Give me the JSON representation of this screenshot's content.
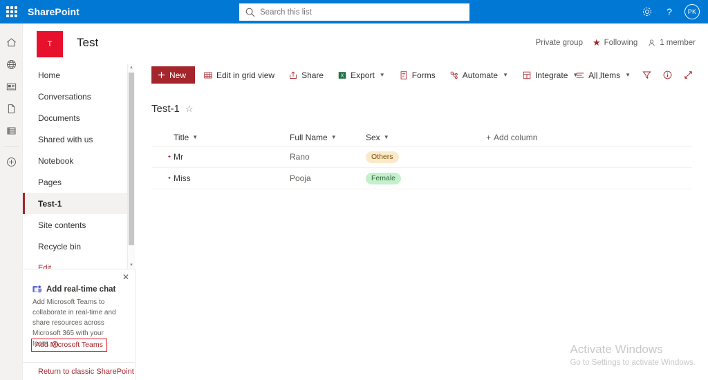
{
  "suite": {
    "waffle_name": "app-launcher",
    "brand": "SharePoint",
    "search_placeholder": "Search this list",
    "settings_glyph": "⚙",
    "help_glyph": "?",
    "avatar_initials": "PK",
    "bar_color": "#0078d4"
  },
  "rail": {
    "items": [
      {
        "icon": "home-icon"
      },
      {
        "icon": "globe-icon"
      },
      {
        "icon": "news-icon"
      },
      {
        "icon": "page-icon"
      },
      {
        "icon": "lists-icon"
      },
      {
        "icon": "create-icon"
      }
    ]
  },
  "site": {
    "logo_letter": "T",
    "logo_color": "#e8112d",
    "title": "Test",
    "privacy": "Private group",
    "following": "Following",
    "members": "1 member"
  },
  "nav": {
    "items": [
      {
        "label": "Home",
        "selected": false
      },
      {
        "label": "Conversations",
        "selected": false
      },
      {
        "label": "Documents",
        "selected": false
      },
      {
        "label": "Shared with us",
        "selected": false
      },
      {
        "label": "Notebook",
        "selected": false
      },
      {
        "label": "Pages",
        "selected": false
      },
      {
        "label": "Test-1",
        "selected": true
      },
      {
        "label": "Site contents",
        "selected": false
      },
      {
        "label": "Recycle bin",
        "selected": false
      },
      {
        "label": "Edit",
        "selected": false
      }
    ]
  },
  "toolbar": {
    "new_label": "New",
    "new_color": "#a4262c",
    "commands": [
      {
        "label": "Edit in grid view",
        "icon": "grid-icon",
        "caret": false
      },
      {
        "label": "Share",
        "icon": "share-icon",
        "caret": false
      },
      {
        "label": "Export",
        "icon": "excel-icon",
        "caret": true
      },
      {
        "label": "Forms",
        "icon": "forms-icon",
        "caret": false
      },
      {
        "label": "Automate",
        "icon": "automate-icon",
        "caret": true
      },
      {
        "label": "Integrate",
        "icon": "integrate-icon",
        "caret": true
      }
    ],
    "overflow_label": "…",
    "view_label": "All Items",
    "filter_icon": "filter-icon",
    "info_icon": "info-icon",
    "expand_icon": "expand-icon"
  },
  "list": {
    "title": "Test-1",
    "favorite_glyph": "☆",
    "columns": [
      {
        "label": "Title"
      },
      {
        "label": "Full Name"
      },
      {
        "label": "Sex"
      }
    ],
    "add_column_label": "Add column",
    "rows": [
      {
        "title": "Mr",
        "full_name": "Rano",
        "sex": "Others",
        "sex_bg": "#fbeaca",
        "sex_fg": "#7a4d00"
      },
      {
        "title": "Miss",
        "full_name": "Pooja",
        "sex": "Female",
        "sex_bg": "#c6efce",
        "sex_fg": "#2d6b34"
      }
    ]
  },
  "promo": {
    "close_glyph": "✕",
    "heading": "Add real-time chat",
    "body": "Add Microsoft Teams to collaborate in real-time and share resources across Microsoft 365 with your team.",
    "info_glyph": "i",
    "link_label": "Add Microsoft Teams",
    "link_border": "#e81123",
    "classic_link": "Return to classic SharePoint"
  },
  "watermark": {
    "line1": "Activate Windows",
    "line2": "Go to Settings to activate Windows."
  }
}
